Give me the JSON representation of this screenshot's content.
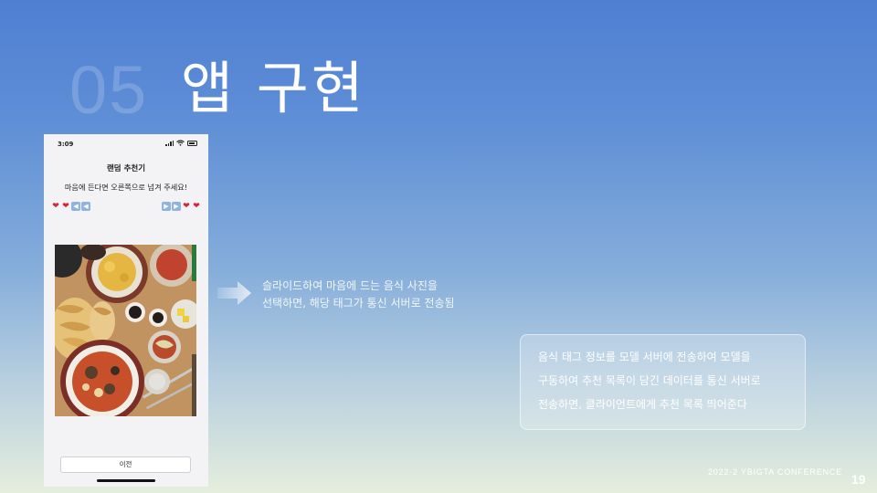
{
  "section": {
    "number": "05",
    "title": "앱 구현"
  },
  "phone": {
    "status_time": "3:09",
    "app_title": "랜덤 추천기",
    "subtitle": "마음에 든다면 오른쪽으로 넘겨 주세요!",
    "hint_left_icons": [
      "broken-heart-icon",
      "broken-heart-icon",
      "arrow-left-icon",
      "arrow-left-icon"
    ],
    "hint_right_icons": [
      "arrow-right-icon",
      "arrow-right-icon",
      "heart-icon",
      "heart-icon"
    ],
    "prev_button_label": "이전"
  },
  "caption_1": {
    "line1": "슬라이드하여 마음에 드는 음식 사진을",
    "line2": "선택하면, 해당 태그가 통신 서버로 전송됨"
  },
  "info_box": {
    "line1": "음식 태그 정보를 모델 서버에 전송하여 모델을",
    "line2": "구동하여 추천 목록이 담긴 데이터를 통신 서버로",
    "line3": "전송하면, 클라이언트에게 추천 목록 띄어준다"
  },
  "footer": {
    "conference": "2022-2 YBIGTA CONFERENCE",
    "page": "19"
  }
}
